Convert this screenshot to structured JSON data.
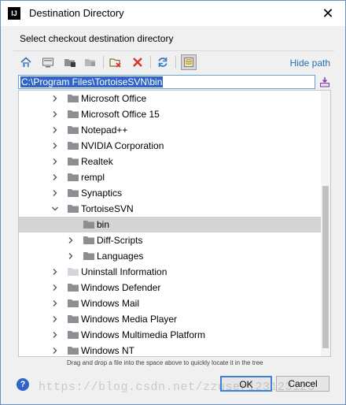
{
  "window": {
    "app_icon_text": "IJ",
    "title": "Destination Directory",
    "close_glyph": "✕"
  },
  "prompt": "Select checkout destination directory",
  "toolbar": {
    "buttons": [
      {
        "icon": "home-icon"
      },
      {
        "icon": "desktop-icon"
      },
      {
        "icon": "project-icon"
      },
      {
        "icon": "module-icon"
      },
      {
        "icon": "new-folder-icon"
      },
      {
        "icon": "delete-icon"
      },
      {
        "icon": "refresh-icon"
      },
      {
        "icon": "show-hidden-icon",
        "pressed": true
      }
    ],
    "hide_path_label": "Hide path"
  },
  "path": {
    "value": "C:\\Program Files\\TortoiseSVN\\bin"
  },
  "tree": {
    "rows": [
      {
        "label": "Microsoft Office",
        "expanded": false,
        "has_children": true
      },
      {
        "label": "Microsoft Office 15",
        "expanded": false,
        "has_children": true
      },
      {
        "label": "Notepad++",
        "expanded": false,
        "has_children": true
      },
      {
        "label": "NVIDIA Corporation",
        "expanded": false,
        "has_children": true
      },
      {
        "label": "Realtek",
        "expanded": false,
        "has_children": true
      },
      {
        "label": "rempl",
        "expanded": false,
        "has_children": true
      },
      {
        "label": "Synaptics",
        "expanded": false,
        "has_children": true
      },
      {
        "label": "TortoiseSVN",
        "expanded": true,
        "has_children": true
      },
      {
        "label": "bin",
        "expanded": false,
        "has_children": false,
        "selected": true
      },
      {
        "label": "Diff-Scripts",
        "expanded": false,
        "has_children": true
      },
      {
        "label": "Languages",
        "expanded": false,
        "has_children": true
      },
      {
        "label": "Uninstall Information",
        "expanded": false,
        "has_children": true,
        "light_folder": true
      },
      {
        "label": "Windows Defender",
        "expanded": false,
        "has_children": true
      },
      {
        "label": "Windows Mail",
        "expanded": false,
        "has_children": true
      },
      {
        "label": "Windows Media Player",
        "expanded": false,
        "has_children": true
      },
      {
        "label": "Windows Multimedia Platform",
        "expanded": false,
        "has_children": true
      },
      {
        "label": "Windows NT",
        "expanded": false,
        "has_children": true
      }
    ],
    "scroll_position_fraction": 0.7
  },
  "hint": "Drag and drop a file into the space above to quickly locate it in the tree",
  "buttons": {
    "help": "?",
    "ok": "OK",
    "cancel": "Cancel"
  },
  "watermark": "https://blog.csdn.net/zzuser123123123",
  "colors": {
    "selection": "#2f65c6",
    "link": "#2470b3",
    "folder": "#8b8f94"
  }
}
